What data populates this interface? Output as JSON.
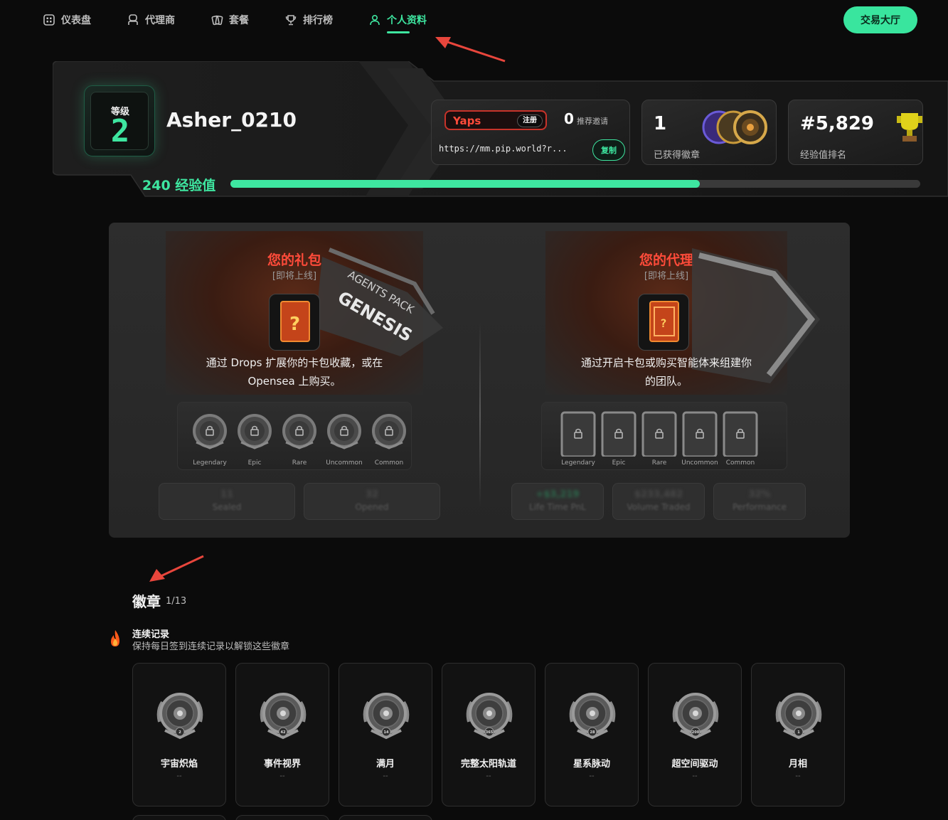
{
  "nav": {
    "items": [
      {
        "label": "仪表盘",
        "icon": "dashboard-icon"
      },
      {
        "label": "代理商",
        "icon": "agent-icon"
      },
      {
        "label": "套餐",
        "icon": "cards-icon"
      },
      {
        "label": "排行榜",
        "icon": "trophy-icon"
      },
      {
        "label": "个人资料",
        "icon": "user-icon",
        "active": true
      }
    ],
    "trade_button": "交易大厅"
  },
  "profile": {
    "level_label": "等级",
    "level": "2",
    "username": "Asher_0210",
    "referral": {
      "yaps_label": "Yaps",
      "register_tag": "注册",
      "count": "0",
      "count_label": "推荐邀请",
      "url": "https://mm.pip.world?r...",
      "copy_label": "复制"
    },
    "badges_stat": {
      "value": "1",
      "label": "已获得徽章"
    },
    "rank_stat": {
      "value": "#5,829",
      "label": "经验值排名"
    },
    "xp": {
      "label": "240 经验值",
      "progress": 0.68
    }
  },
  "packs": {
    "title": "您的礼包",
    "subtitle": "[即将上线]",
    "description_1": "通过 Drops 扩展你的卡包收藏，或在",
    "description_2": "Opensea 上购买。",
    "pack_art_text_1": "AGENTS PACK",
    "pack_art_text_2": "GENESIS",
    "rarities": [
      "Legendary",
      "Epic",
      "Rare",
      "Uncommon",
      "Common"
    ],
    "stats": [
      {
        "value": "11",
        "label": "Sealed"
      },
      {
        "value": "32",
        "label": "Opened"
      }
    ]
  },
  "agents": {
    "title": "您的代理",
    "subtitle": "[即将上线]",
    "description_1": "通过开启卡包或购买智能体来组建你",
    "description_2": "的团队。",
    "rarities": [
      "Legendary",
      "Epic",
      "Rare",
      "Uncommon",
      "Common"
    ],
    "stats": [
      {
        "value": "+$3,219",
        "label": "Life Time PnL"
      },
      {
        "value": "$233,482",
        "label": "Volume Traded"
      },
      {
        "value": "32%",
        "label": "Performance"
      }
    ]
  },
  "badges": {
    "title": "徽章",
    "count": "1/13",
    "section_title": "连续记录",
    "section_desc": "保持每日签到连续记录以解锁这些徽章",
    "items": [
      {
        "name": "宇宙炽焰",
        "value": "--",
        "tier": "2"
      },
      {
        "name": "事件视界",
        "value": "--",
        "tier": "42"
      },
      {
        "name": "满月",
        "value": "--",
        "tier": "14"
      },
      {
        "name": "完整太阳轨道",
        "value": "--",
        "tier": "365"
      },
      {
        "name": "星系脉动",
        "value": "--",
        "tier": "28"
      },
      {
        "name": "超空间驱动",
        "value": "--",
        "tier": "200"
      },
      {
        "name": "月相",
        "value": "--",
        "tier": "1"
      }
    ]
  },
  "colors": {
    "accent": "#3ee6a0",
    "danger": "#ff4b3a",
    "background": "#0b0b0b"
  }
}
